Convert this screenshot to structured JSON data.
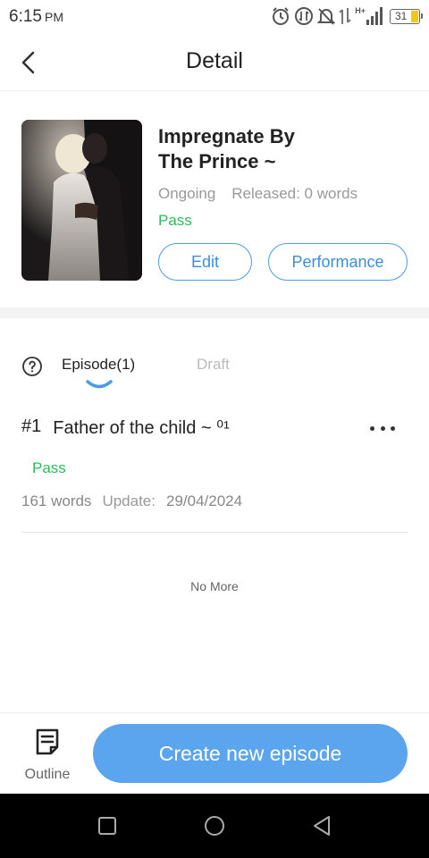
{
  "status_bar": {
    "time": "6:15",
    "ampm": "PM",
    "network": "H+",
    "battery": "31"
  },
  "header": {
    "title": "Detail"
  },
  "book": {
    "title_line1": "Impregnate By",
    "title_line2": "The Prince ~",
    "state": "Ongoing",
    "released": "Released: 0 words",
    "review_status": "Pass",
    "edit_label": "Edit",
    "performance_label": "Performance"
  },
  "tabs": {
    "episode_label": "Episode(1)",
    "draft_label": "Draft"
  },
  "episodes": [
    {
      "number": "#1",
      "title": "Father of the child ~ ⁰¹",
      "status": "Pass",
      "words": "161 words",
      "update_label": "Update:",
      "update_date": "29/04/2024"
    }
  ],
  "list_footer": "No More",
  "bottom_bar": {
    "outline_label": "Outline",
    "create_label": "Create new episode"
  },
  "colors": {
    "accent": "#5aa5ee",
    "outline_accent": "#3b8ede",
    "pass": "#2dbb5a"
  }
}
